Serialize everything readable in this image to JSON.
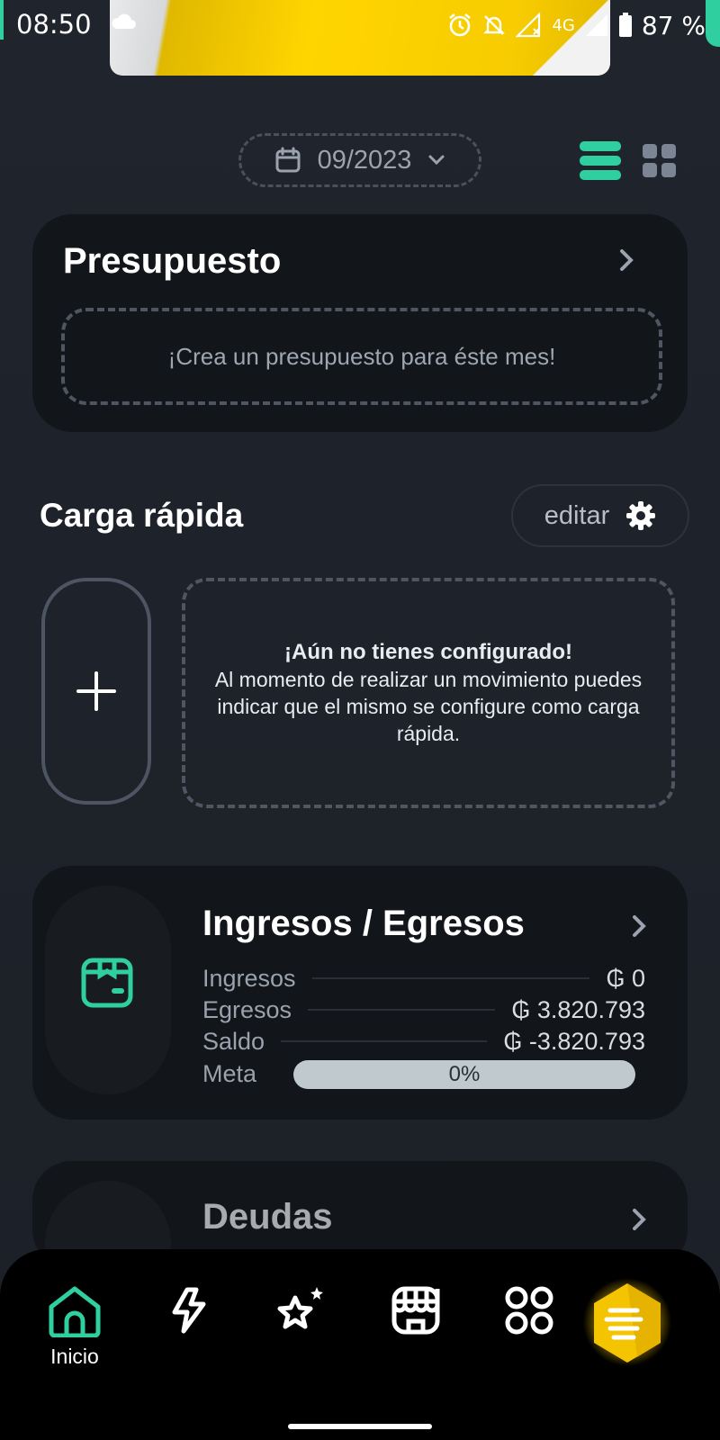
{
  "status_bar": {
    "time": "08:50",
    "network": "4G",
    "battery": "87 %"
  },
  "header": {
    "date_selector": "09/2023",
    "view_list_icon": "list-view-icon",
    "view_grid_icon": "grid-view-icon"
  },
  "presupuesto": {
    "title": "Presupuesto",
    "empty_message": "¡Crea un presupuesto para éste mes!"
  },
  "carga_rapida": {
    "title": "Carga rápida",
    "edit_label": "editar",
    "empty_title": "¡Aún no tienes configurado!",
    "empty_body": "Al momento de realizar un movimiento puedes indicar que el mismo se configure como carga rápida."
  },
  "ingresos_egresos": {
    "title": "Ingresos / Egresos",
    "rows": [
      {
        "label": "Ingresos",
        "value": "₲ 0"
      },
      {
        "label": "Egresos",
        "value": "₲ 3.820.793"
      },
      {
        "label": "Saldo",
        "value": "₲ -3.820.793"
      }
    ],
    "meta_label": "Meta",
    "meta_value": "0%",
    "meta_progress": 0
  },
  "deudas": {
    "title": "Deudas"
  },
  "bottom_nav": {
    "items": [
      {
        "label": "Inicio",
        "icon": "home-icon",
        "active": true
      },
      {
        "label": "",
        "icon": "bolt-icon"
      },
      {
        "label": "",
        "icon": "stars-icon"
      },
      {
        "label": "",
        "icon": "store-icon"
      },
      {
        "label": "",
        "icon": "apps-icon"
      }
    ],
    "fab_icon": "coins-icon"
  },
  "colors": {
    "accent": "#2fcf9f",
    "background": "#1e222a",
    "card": "#121519",
    "fab": "#f5c400"
  }
}
